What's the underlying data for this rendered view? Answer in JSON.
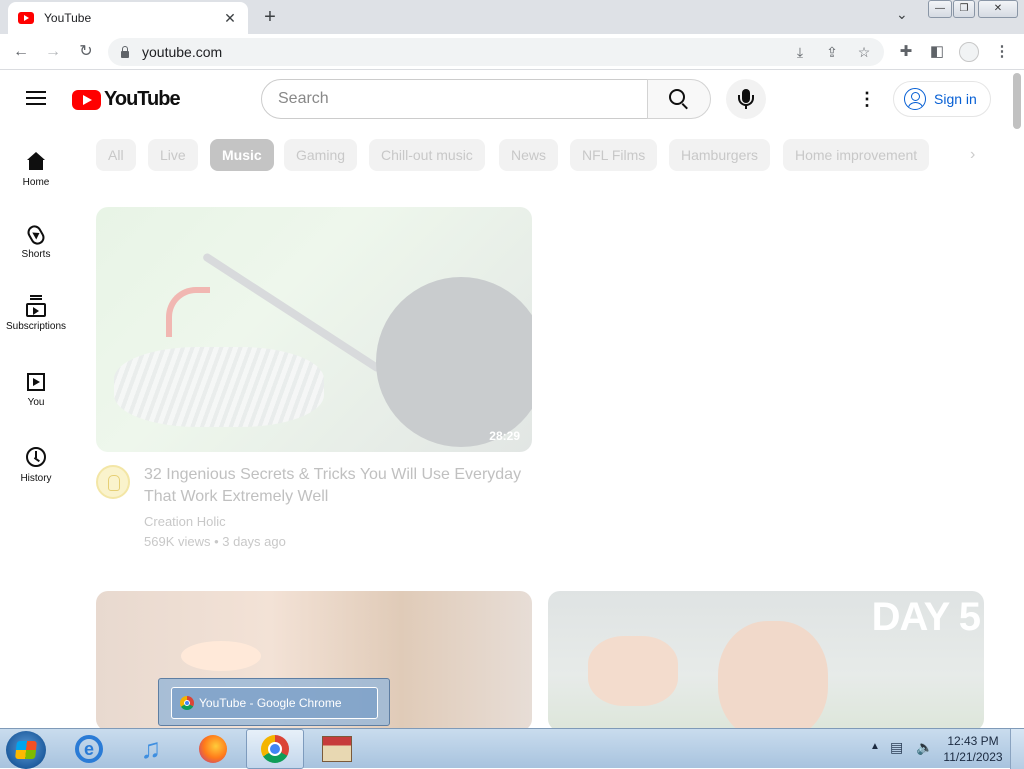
{
  "browser": {
    "tab_title": "YouTube",
    "tab_close": "✕",
    "new_tab": "+",
    "tab_list_chevron": "⌄",
    "url": "youtube.com",
    "window_controls": [
      "—",
      "❐",
      "✕"
    ]
  },
  "youtube": {
    "logo_text": "YouTube",
    "search_placeholder": "Search",
    "kebab": "⋮",
    "sign_in": "Sign in",
    "sidebar": [
      {
        "label": "Home",
        "icon": "home-icon"
      },
      {
        "label": "Shorts",
        "icon": "shorts-icon"
      },
      {
        "label": "Subscriptions",
        "icon": "subscriptions-icon"
      },
      {
        "label": "You",
        "icon": "you-icon"
      },
      {
        "label": "History",
        "icon": "history-icon"
      }
    ],
    "chips": [
      "All",
      "Live",
      "Music",
      "Gaming",
      "Chill-out music",
      "News",
      "NFL Films",
      "Hamburgers",
      "Home improvement"
    ],
    "active_chip": "Music",
    "chip_next": "›",
    "videos": [
      {
        "title": "32 Ingenious Secrets & Tricks You Will Use Everyday That Work Extremely Well",
        "channel": "Creation Holic",
        "meta": "569K views • 3 days ago",
        "duration": "28:29"
      },
      {
        "overlay_text": ""
      },
      {
        "overlay_text": "DAY 5"
      }
    ]
  },
  "taskbar": {
    "popup_title": "YouTube - Google Chrome",
    "time": "12:43 PM",
    "date": "11/21/2023",
    "apps": [
      "internet-explorer-icon",
      "itunes-icon",
      "firefox-icon",
      "chrome-icon",
      "store-icon"
    ]
  },
  "colors": {
    "youtube_red": "#ff0000",
    "signin_blue": "#065fd4",
    "tabbar_bg": "#dee1e6"
  }
}
